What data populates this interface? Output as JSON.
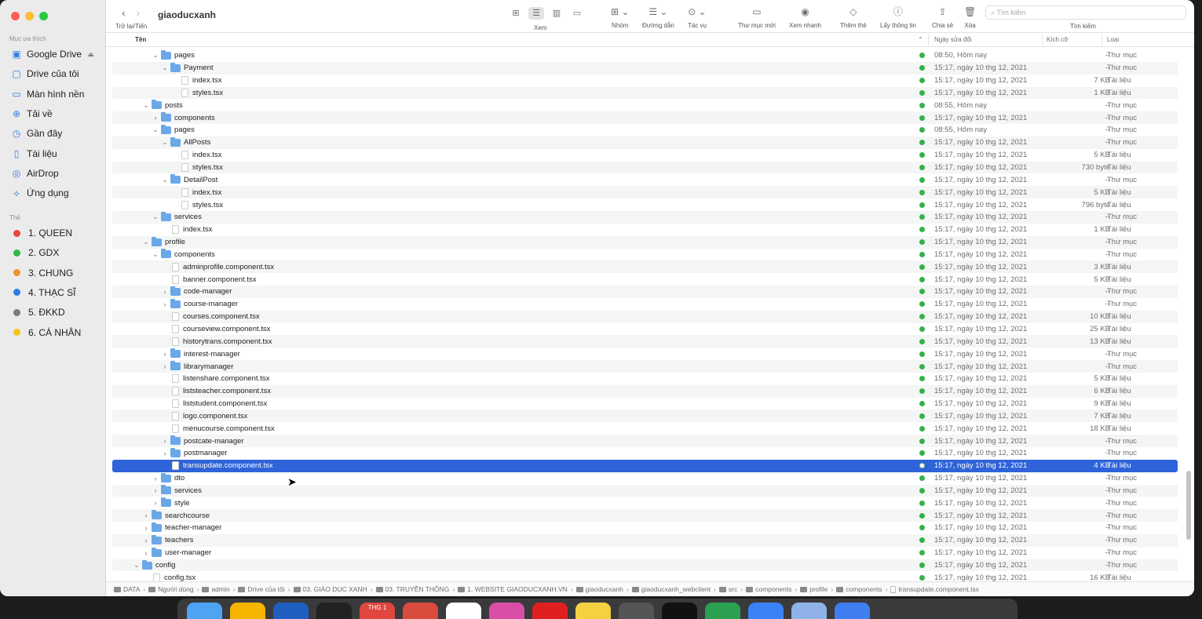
{
  "window": {
    "title": "giaoducxanh"
  },
  "toolbar": {
    "nav_label": "Trở lại/Tiến",
    "view_label": "Xem",
    "group_label": "Nhóm",
    "path_label": "Đường dẫn",
    "action_label": "Tác vụ",
    "new_folder_label": "Thư mục mới",
    "quicklook_label": "Xem nhanh",
    "tag_label": "Thêm thẻ",
    "info_label": "Lấy thông tin",
    "share_label": "Chia sẻ",
    "delete_label": "Xóa",
    "search_placeholder": "Tìm kiếm",
    "search_label": "Tìm kiếm"
  },
  "sidebar": {
    "favorites_title": "Mục ưa thích",
    "favorites": [
      {
        "label": "Google Drive",
        "icon": "drive-icon"
      },
      {
        "label": "Drive của tôi",
        "icon": "folder-icon"
      },
      {
        "label": "Màn hình nền",
        "icon": "desktop-icon"
      },
      {
        "label": "Tải về",
        "icon": "download-icon"
      },
      {
        "label": "Gần đây",
        "icon": "clock-icon"
      },
      {
        "label": "Tài liệu",
        "icon": "document-icon"
      },
      {
        "label": "AirDrop",
        "icon": "airdrop-icon"
      },
      {
        "label": "Ứng dụng",
        "icon": "apps-icon"
      }
    ],
    "tags_title": "Thẻ",
    "tags": [
      {
        "label": "1. QUEEN",
        "color": "#e8453c"
      },
      {
        "label": "2. GDX",
        "color": "#2fb84a"
      },
      {
        "label": "3. CHUNG",
        "color": "#f0932b"
      },
      {
        "label": "4. THẠC SĨ",
        "color": "#2f7de1"
      },
      {
        "label": "5. ĐKKD",
        "color": "#7a7a7a"
      },
      {
        "label": "6. CÁ NHÂN",
        "color": "#f5c518"
      }
    ]
  },
  "columns": {
    "name": "Tên",
    "modified": "Ngày sửa đổi",
    "size": "Kích cỡ",
    "kind": "Loại"
  },
  "rows": [
    {
      "name": "pages",
      "depth": 2,
      "type": "folder",
      "open": true,
      "date": "08:50, Hôm nay",
      "size": "--",
      "kind": "Thư mục"
    },
    {
      "name": "Payment",
      "depth": 3,
      "type": "folder",
      "open": true,
      "date": "15:17, ngày 10 thg 12, 2021",
      "size": "--",
      "kind": "Thư mục"
    },
    {
      "name": "index.tsx",
      "depth": 4,
      "type": "file",
      "date": "15:17, ngày 10 thg 12, 2021",
      "size": "7 KB",
      "kind": "Tài liệu"
    },
    {
      "name": "styles.tsx",
      "depth": 4,
      "type": "file",
      "date": "15:17, ngày 10 thg 12, 2021",
      "size": "1 KB",
      "kind": "Tài liệu"
    },
    {
      "name": "posts",
      "depth": 1,
      "type": "folder",
      "open": true,
      "date": "08:55, Hôm nay",
      "size": "--",
      "kind": "Thư mục"
    },
    {
      "name": "components",
      "depth": 2,
      "type": "folder",
      "open": false,
      "date": "15:17, ngày 10 thg 12, 2021",
      "size": "--",
      "kind": "Thư mục"
    },
    {
      "name": "pages",
      "depth": 2,
      "type": "folder",
      "open": true,
      "date": "08:55, Hôm nay",
      "size": "--",
      "kind": "Thư mục"
    },
    {
      "name": "AllPosts",
      "depth": 3,
      "type": "folder",
      "open": true,
      "date": "15:17, ngày 10 thg 12, 2021",
      "size": "--",
      "kind": "Thư mục"
    },
    {
      "name": "index.tsx",
      "depth": 4,
      "type": "file",
      "date": "15:17, ngày 10 thg 12, 2021",
      "size": "5 KB",
      "kind": "Tài liệu"
    },
    {
      "name": "styles.tsx",
      "depth": 4,
      "type": "file",
      "date": "15:17, ngày 10 thg 12, 2021",
      "size": "730 byte",
      "kind": "Tài liệu"
    },
    {
      "name": "DetailPost",
      "depth": 3,
      "type": "folder",
      "open": true,
      "date": "15:17, ngày 10 thg 12, 2021",
      "size": "--",
      "kind": "Thư mục"
    },
    {
      "name": "index.tsx",
      "depth": 4,
      "type": "file",
      "date": "15:17, ngày 10 thg 12, 2021",
      "size": "5 KB",
      "kind": "Tài liệu"
    },
    {
      "name": "styles.tsx",
      "depth": 4,
      "type": "file",
      "date": "15:17, ngày 10 thg 12, 2021",
      "size": "796 byte",
      "kind": "Tài liệu"
    },
    {
      "name": "services",
      "depth": 2,
      "type": "folder",
      "open": true,
      "date": "15:17, ngày 10 thg 12, 2021",
      "size": "--",
      "kind": "Thư mục"
    },
    {
      "name": "index.tsx",
      "depth": 3,
      "type": "file",
      "date": "15:17, ngày 10 thg 12, 2021",
      "size": "1 KB",
      "kind": "Tài liệu"
    },
    {
      "name": "profile",
      "depth": 1,
      "type": "folder",
      "open": true,
      "date": "15:17, ngày 10 thg 12, 2021",
      "size": "--",
      "kind": "Thư mục"
    },
    {
      "name": "components",
      "depth": 2,
      "type": "folder",
      "open": true,
      "date": "15:17, ngày 10 thg 12, 2021",
      "size": "--",
      "kind": "Thư mục"
    },
    {
      "name": "adminprofile.component.tsx",
      "depth": 3,
      "type": "file",
      "date": "15:17, ngày 10 thg 12, 2021",
      "size": "3 KB",
      "kind": "Tài liệu"
    },
    {
      "name": "banner.component.tsx",
      "depth": 3,
      "type": "file",
      "date": "15:17, ngày 10 thg 12, 2021",
      "size": "5 KB",
      "kind": "Tài liệu"
    },
    {
      "name": "code-manager",
      "depth": 3,
      "type": "folder",
      "open": false,
      "date": "15:17, ngày 10 thg 12, 2021",
      "size": "--",
      "kind": "Thư mục"
    },
    {
      "name": "course-manager",
      "depth": 3,
      "type": "folder",
      "open": false,
      "date": "15:17, ngày 10 thg 12, 2021",
      "size": "--",
      "kind": "Thư mục"
    },
    {
      "name": "courses.component.tsx",
      "depth": 3,
      "type": "file",
      "date": "15:17, ngày 10 thg 12, 2021",
      "size": "10 KB",
      "kind": "Tài liệu"
    },
    {
      "name": "courseview.component.tsx",
      "depth": 3,
      "type": "file",
      "date": "15:17, ngày 10 thg 12, 2021",
      "size": "25 KB",
      "kind": "Tài liệu"
    },
    {
      "name": "historytrans.component.tsx",
      "depth": 3,
      "type": "file",
      "date": "15:17, ngày 10 thg 12, 2021",
      "size": "13 KB",
      "kind": "Tài liệu"
    },
    {
      "name": "interest-manager",
      "depth": 3,
      "type": "folder",
      "open": false,
      "date": "15:17, ngày 10 thg 12, 2021",
      "size": "--",
      "kind": "Thư mục"
    },
    {
      "name": "librarymanager",
      "depth": 3,
      "type": "folder",
      "open": false,
      "date": "15:17, ngày 10 thg 12, 2021",
      "size": "--",
      "kind": "Thư mục"
    },
    {
      "name": "listenshare.component.tsx",
      "depth": 3,
      "type": "file",
      "date": "15:17, ngày 10 thg 12, 2021",
      "size": "5 KB",
      "kind": "Tài liệu"
    },
    {
      "name": "liststeacher.component.tsx",
      "depth": 3,
      "type": "file",
      "date": "15:17, ngày 10 thg 12, 2021",
      "size": "6 KB",
      "kind": "Tài liệu"
    },
    {
      "name": "liststudent.component.tsx",
      "depth": 3,
      "type": "file",
      "date": "15:17, ngày 10 thg 12, 2021",
      "size": "9 KB",
      "kind": "Tài liệu"
    },
    {
      "name": "logo.component.tsx",
      "depth": 3,
      "type": "file",
      "date": "15:17, ngày 10 thg 12, 2021",
      "size": "7 KB",
      "kind": "Tài liệu"
    },
    {
      "name": "menucourse.component.tsx",
      "depth": 3,
      "type": "file",
      "date": "15:17, ngày 10 thg 12, 2021",
      "size": "18 KB",
      "kind": "Tài liệu"
    },
    {
      "name": "postcate-manager",
      "depth": 3,
      "type": "folder",
      "open": false,
      "date": "15:17, ngày 10 thg 12, 2021",
      "size": "--",
      "kind": "Thư mục"
    },
    {
      "name": "postmanager",
      "depth": 3,
      "type": "folder",
      "open": false,
      "date": "15:17, ngày 10 thg 12, 2021",
      "size": "--",
      "kind": "Thư mục"
    },
    {
      "name": "transupdate.component.tsx",
      "depth": 3,
      "type": "file",
      "selected": true,
      "date": "15:17, ngày 10 thg 12, 2021",
      "size": "4 KB",
      "kind": "Tài liệu"
    },
    {
      "name": "dto",
      "depth": 2,
      "type": "folder",
      "open": false,
      "date": "15:17, ngày 10 thg 12, 2021",
      "size": "--",
      "kind": "Thư mục"
    },
    {
      "name": "services",
      "depth": 2,
      "type": "folder",
      "open": false,
      "date": "15:17, ngày 10 thg 12, 2021",
      "size": "--",
      "kind": "Thư mục"
    },
    {
      "name": "style",
      "depth": 2,
      "type": "folder",
      "open": false,
      "date": "15:17, ngày 10 thg 12, 2021",
      "size": "--",
      "kind": "Thư mục"
    },
    {
      "name": "searchcourse",
      "depth": 1,
      "type": "folder",
      "open": false,
      "date": "15:17, ngày 10 thg 12, 2021",
      "size": "--",
      "kind": "Thư mục"
    },
    {
      "name": "teacher-manager",
      "depth": 1,
      "type": "folder",
      "open": false,
      "date": "15:17, ngày 10 thg 12, 2021",
      "size": "--",
      "kind": "Thư mục"
    },
    {
      "name": "teachers",
      "depth": 1,
      "type": "folder",
      "open": false,
      "date": "15:17, ngày 10 thg 12, 2021",
      "size": "--",
      "kind": "Thư mục"
    },
    {
      "name": "user-manager",
      "depth": 1,
      "type": "folder",
      "open": false,
      "date": "15:17, ngày 10 thg 12, 2021",
      "size": "--",
      "kind": "Thư mục"
    },
    {
      "name": "config",
      "depth": 0,
      "type": "folder",
      "open": true,
      "date": "15:17, ngày 10 thg 12, 2021",
      "size": "--",
      "kind": "Thư mục"
    },
    {
      "name": "config.tsx",
      "depth": 1,
      "type": "file",
      "date": "15:17, ngày 10 thg 12, 2021",
      "size": "16 KB",
      "kind": "Tài liệu"
    }
  ],
  "pathbar": [
    "DATA",
    "Người dùng",
    "admin",
    "Drive của tôi",
    "03. GIÁO DỤC XANH",
    "03. TRUYỀN THÔNG",
    "1. WEBSITE GIAODUCXANH.VN",
    "giaoducxanh",
    "giaoducxanh_webclient",
    "src",
    "components",
    "profile",
    "components",
    "transupdate.component.tsx"
  ],
  "dock": {
    "calendar_badge": "THG 1"
  }
}
